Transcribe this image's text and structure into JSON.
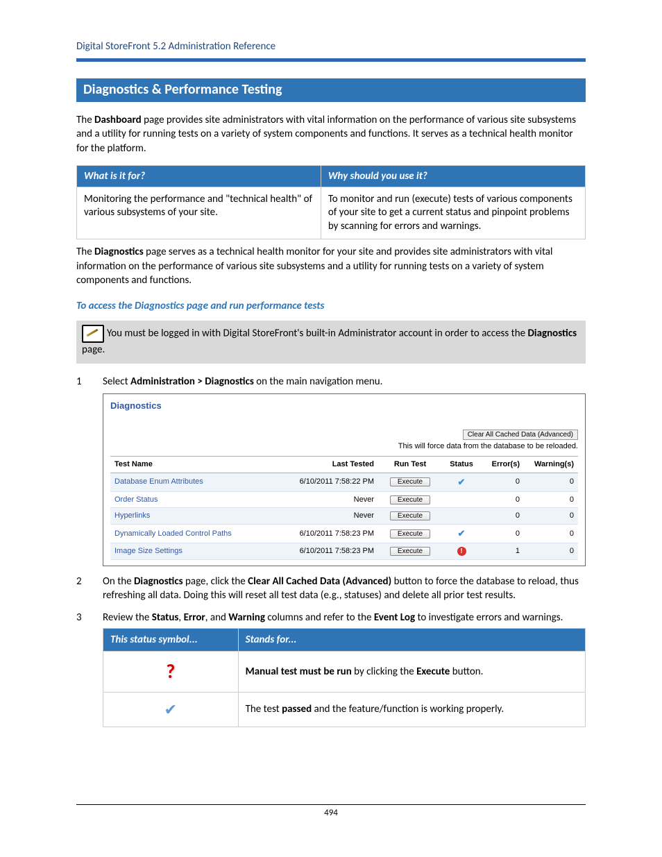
{
  "header": {
    "doc_title": "Digital StoreFront 5.2 Administration Reference"
  },
  "section_heading": "Diagnostics & Performance Testing",
  "intro": {
    "pre": "The ",
    "bold1": "Dashboard",
    "post": " page provides site administrators with vital information on the performance of various site subsystems and a utility for running tests on a variety of system components and functions. It serves as a technical health monitor for the platform."
  },
  "info_table": {
    "h1": "What is it for?",
    "h2": "Why should you use it?",
    "c1": "Monitoring the performance and \"technical health\" of various subsystems of your site.",
    "c2": "To monitor and run (execute) tests of various components of your site to get a current status and pinpoint problems by scanning for errors and warnings."
  },
  "diag_para": {
    "pre": "The ",
    "bold": "Diagnostics",
    "post": " page serves as a technical health monitor for your site and provides site administrators with vital information on the performance of various site subsystems and a utility for running tests on a variety of system components and functions."
  },
  "subheading": "To access the Diagnostics page and run performance tests",
  "note": {
    "pre": "You must be logged in with Digital StoreFront's built-in Administrator account in order to access the ",
    "bold": "Diagnostics",
    "post": " page."
  },
  "steps": {
    "s1": {
      "pre": "Select ",
      "bold": "Administration > Diagnostics",
      "post": " on the main navigation menu."
    },
    "s2": {
      "pre": "On the ",
      "b1": "Diagnostics",
      "mid1": " page, click the ",
      "b2": "Clear All Cached Data (Advanced)",
      "post": " button to force the database to reload, thus refreshing all data. Doing this will reset all test data (e.g., statuses) and delete all prior test results."
    },
    "s3": {
      "pre": "Review the ",
      "b1": "Status",
      "c1": ", ",
      "b2": "Error",
      "c2": ", and ",
      "b3": "Warning",
      "mid": " columns and refer to the ",
      "b4": "Event Log",
      "post": " to investigate errors and warnings."
    }
  },
  "diag_panel": {
    "title": "Diagnostics",
    "clear_button": "Clear All Cached Data (Advanced)",
    "clear_desc": "This will force data from the database to be reloaded.",
    "headers": {
      "name": "Test Name",
      "last": "Last Tested",
      "run": "Run Test",
      "status": "Status",
      "err": "Error(s)",
      "warn": "Warning(s)"
    },
    "exec_label": "Execute",
    "rows": [
      {
        "name": "Database Enum Attributes",
        "last": "6/10/2011 7:58:22 PM",
        "status": "check",
        "err": "0",
        "warn": "0"
      },
      {
        "name": "Order Status",
        "last": "Never",
        "status": "",
        "err": "0",
        "warn": "0"
      },
      {
        "name": "Hyperlinks",
        "last": "Never",
        "status": "",
        "err": "0",
        "warn": "0"
      },
      {
        "name": "Dynamically Loaded Control Paths",
        "last": "6/10/2011 7:58:23 PM",
        "status": "check",
        "err": "0",
        "warn": "0"
      },
      {
        "name": "Image Size Settings",
        "last": "6/10/2011 7:58:23 PM",
        "status": "alert",
        "err": "1",
        "warn": "0"
      }
    ]
  },
  "status_table": {
    "h1": "This status symbol...",
    "h2": "Stands for...",
    "r1": {
      "b1": "Manual test must be run",
      "mid": " by clicking the ",
      "b2": "Execute",
      "post": " button."
    },
    "r2": {
      "pre": "The test ",
      "b1": "passed",
      "post": " and the feature/function is working properly."
    }
  },
  "page_number": "494"
}
